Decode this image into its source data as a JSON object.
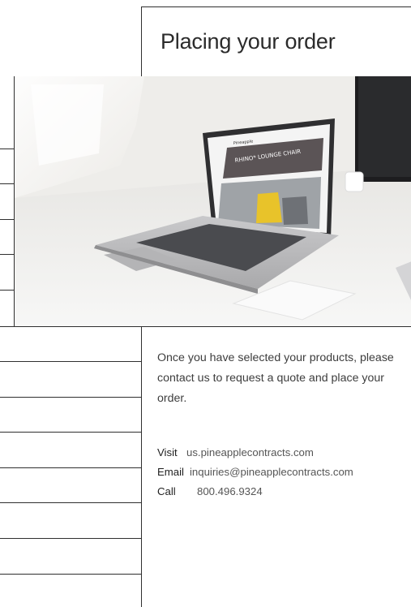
{
  "page": {
    "title": "Placing your order"
  },
  "photo": {
    "icon": "laptop-on-desk-photo",
    "laptop_screen": {
      "brand": "Pineapple",
      "headline": "RHINO* LOUNGE CHAIR"
    }
  },
  "content": {
    "body": "Once you have selected your products, please contact us to request a quote and place your order."
  },
  "contacts": [
    {
      "label": "Visit",
      "value": "us.pineapplecontracts.com"
    },
    {
      "label": "Email",
      "value": "inquiries@pineapplecontracts.com"
    },
    {
      "label": "Call",
      "value": "800.496.9324"
    }
  ],
  "colors": {
    "rule": "#2f2f2f",
    "text": "#3d3d3d",
    "background": "#ffffff"
  }
}
